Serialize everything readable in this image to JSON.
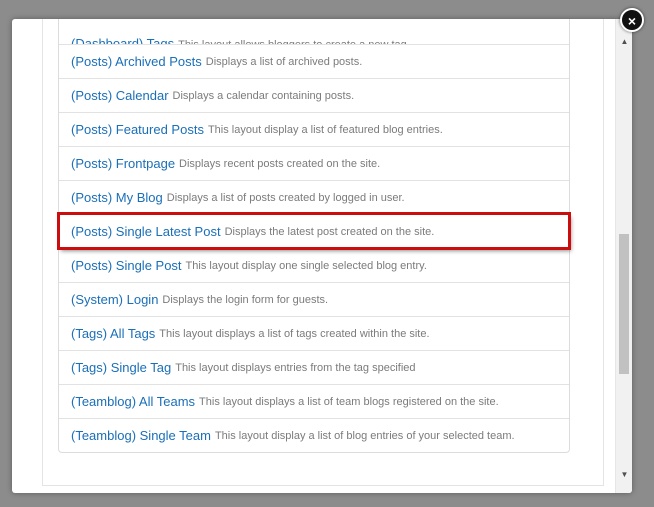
{
  "dialog": {
    "close_icon": "close-icon",
    "close_glyph": "×"
  },
  "layouts": [
    {
      "title": "(Dashboard) Tags",
      "desc": "This layout allows bloggers to create a new tag.",
      "partial": true
    },
    {
      "title": "(Posts) Archived Posts",
      "desc": "Displays a list of archived posts."
    },
    {
      "title": "(Posts) Calendar",
      "desc": "Displays a calendar containing posts."
    },
    {
      "title": "(Posts) Featured Posts",
      "desc": "This layout display a list of featured blog entries."
    },
    {
      "title": "(Posts) Frontpage",
      "desc": "Displays recent posts created on the site."
    },
    {
      "title": "(Posts) My Blog",
      "desc": "Displays a list of posts created by logged in user."
    },
    {
      "title": "(Posts) Single Latest Post",
      "desc": "Displays the latest post created on the site.",
      "highlighted": true
    },
    {
      "title": "(Posts) Single Post",
      "desc": "This layout display one single selected blog entry."
    },
    {
      "title": "(System) Login",
      "desc": "Displays the login form for guests."
    },
    {
      "title": "(Tags) All Tags",
      "desc": "This layout displays a list of tags created within the site."
    },
    {
      "title": "(Tags) Single Tag",
      "desc": "This layout displays entries from the tag specified"
    },
    {
      "title": "(Teamblog) All Teams",
      "desc": "This layout displays a list of team blogs registered on the site."
    },
    {
      "title": "(Teamblog) Single Team",
      "desc": "This layout display a list of blog entries of your selected team."
    }
  ],
  "scrollbar": {
    "up_glyph": "▲",
    "down_glyph": "▼",
    "position_fraction": 0.52
  },
  "colors": {
    "link": "#1a6fb8",
    "description": "#7b7b7b",
    "highlight": "#cc0d0d"
  }
}
